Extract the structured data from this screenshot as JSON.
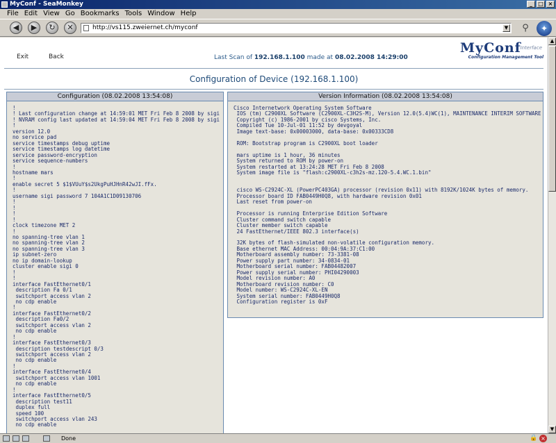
{
  "window": {
    "title": "MyConf - SeaMonkey"
  },
  "menu": [
    "File",
    "Edit",
    "View",
    "Go",
    "Bookmarks",
    "Tools",
    "Window",
    "Help"
  ],
  "address": {
    "url": "http://vs115.zweiernet.ch/myconf"
  },
  "page": {
    "exit_label": "Exit",
    "back_label": "Back",
    "last_scan_prefix": "Last Scan of ",
    "last_scan_ip": "192.168.1.100",
    "last_scan_mid": " made at ",
    "last_scan_time": "08.02.2008 14:29:00",
    "logo_main": "MyConf",
    "logo_sup": "Interface",
    "logo_sub": "Configuration Management Tool",
    "title": "Configuration of Device (192.168.1.100)"
  },
  "config_panel": {
    "header": "Configuration (08.02.2008 13:54:08)",
    "text": "!\n! Last configuration change at 14:59:01 MET Fri Feb 8 2008 by sigi\n! NVRAM config last updated at 14:59:04 MET Fri Feb 8 2008 by sigi\n!\nversion 12.0\nno service pad\nservice timestamps debug uptime\nservice timestamps log datetime\nservice password-encryption\nservice sequence-numbers\n!\nhostname mars\n!\nenable secret 5 $1$VUuY$s2UkgPuHJHnR42wJI.fFx.\n!\nusername sigi password 7 104A1C1D09130706\n!\n!\n!\n!\nclock timezone MET 2\n!\nno spanning-tree vlan 1\nno spanning-tree vlan 2\nno spanning-tree vlan 3\nip subnet-zero\nno ip domain-lookup\ncluster enable sigi 0\n!\n!\ninterface FastEthernet0/1\n description Fa 0/1\n switchport access vlan 2\n no cdp enable\n!\ninterface FastEthernet0/2\n description Fa0/2\n switchport access vlan 2\n no cdp enable\n!\ninterface FastEthernet0/3\n description testdescript 0/3\n switchport access vlan 2\n no cdp enable\n!\ninterface FastEthernet0/4\n switchport access vlan 1001\n no cdp enable\n!\ninterface FastEthernet0/5\n description test11\n duplex full\n speed 100\n switchport access vlan 243\n no cdp enable"
  },
  "version_panel": {
    "header": "Version Information (08.02.2008 13:54:08)",
    "text": "Cisco Internetwork Operating System Software\n IOS (tm) C2900XL Software (C2900XL-C3H2S-M), Version 12.0(5.4)WC(1), MAINTENANCE INTERIM SOFTWARE\n Copyright (c) 1986-2001 by cisco Systems, Inc.\n Compiled Tue 10-Jul-01 11:52 by devgoyal\n Image text-base: 0x00003000, data-base: 0x00333CD8\n\n ROM: Bootstrap program is C2900XL boot loader\n\n mars uptime is 1 hour, 36 minutes\n System returned to ROM by power-on\n System restarted at 13:24:28 MET Fri Feb 8 2008\n System image file is \"flash:c2900XL-c3h2s-mz.120-5.4.WC.1.bin\"\n\n\n cisco WS-C2924C-XL (PowerPC403GA) processor (revision 0x11) with 8192K/1024K bytes of memory.\n Processor board ID FAB0449H0Q8, with hardware revision 0x01\n Last reset from power-on\n\n Processor is running Enterprise Edition Software\n Cluster command switch capable\n Cluster member switch capable\n 24 FastEthernet/IEEE 802.3 interface(s)\n\n 32K bytes of flash-simulated non-volatile configuration memory.\n Base ethernet MAC Address: 00:04:9A:37:C1:00\n Motherboard assembly number: 73-3381-08\n Power supply part number: 34-0834-01\n Motherboard serial number: FAB04482007\n Power supply serial number: PHI04290003\n Model revision number: A0\n Motherboard revision number: C0\n Model number: WS-C2924C-XL-EN\n System serial number: FAB0449H0Q8\n Configuration register is 0xF"
  },
  "status": {
    "text": "Done"
  }
}
